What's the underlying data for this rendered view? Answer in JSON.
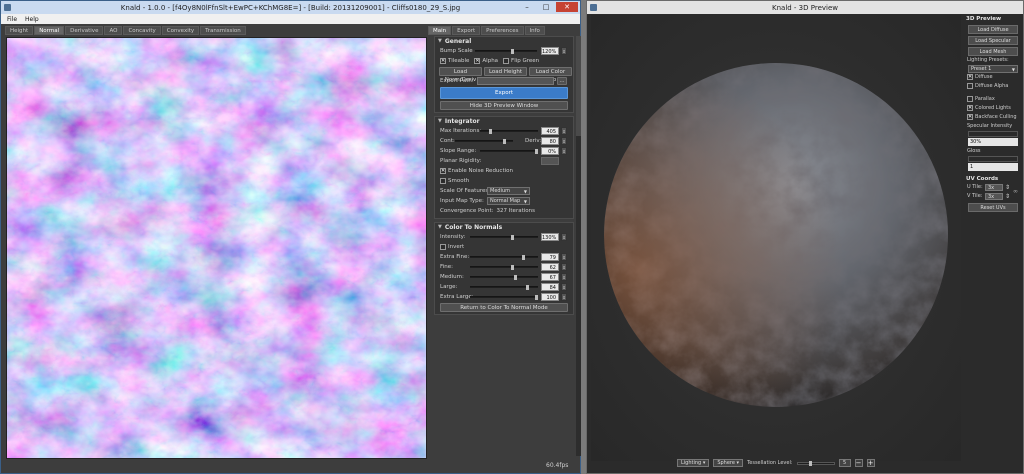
{
  "left_window": {
    "title": "Knald - 1.0.0 - [f4Oy8N0lFfnSlt+EwPC+KChMG8E=] - [Build: 20131209001] - Cliffs0180_29_S.jpg",
    "menu": [
      "File",
      "Help"
    ],
    "map_tabs": [
      "Height",
      "Normal",
      "Derivative",
      "AO",
      "Concavity",
      "Convexity",
      "Transmission"
    ],
    "active_map_tab": "Normal",
    "panel_tabs": [
      "Main",
      "Export",
      "Preferences",
      "Info"
    ],
    "active_panel_tab": "Main",
    "fps": "60.4fps",
    "general": {
      "title": "General",
      "bump_scale_label": "Bump Scale",
      "bump_scale_value": "120%",
      "bump_scale_level": 0.6,
      "tileable": "Tileable",
      "alpha": "Alpha",
      "flip_green": "Flip Green",
      "load_norm_deriv": "Load Norm/Deriv",
      "load_height_map": "Load Height Map",
      "load_color_map": "Load Color Map",
      "export_path_label": "Export Path:",
      "export_path_value": "",
      "browse": "...",
      "export_button": "Export",
      "hide_preview": "Hide 3D Preview Window"
    },
    "integrator": {
      "title": "Integrator",
      "max_iterations_label": "Max Iterations:",
      "max_iterations_value": "405",
      "max_iterations_level": 0.18,
      "cont_label": "Cont:",
      "cont_level": 0.85,
      "deriv_label": "Deriv:",
      "deriv_value": "80",
      "slope_range_label": "Slope Range:",
      "slope_range_value": "0%",
      "slope_range_level": 0.98,
      "planar_rigidity_label": "Planar Rigidity:",
      "enable_noise_reduction": "Enable Noise Reduction",
      "smooth": "Smooth",
      "scale_features_label": "Scale Of Features:",
      "scale_features_value": "Medium",
      "input_map_type_label": "Input Map Type:",
      "input_map_type_value": "Normal Map",
      "convergence_label": "Convergence Point:",
      "convergence_value": "327 Iterations"
    },
    "color_to_normals": {
      "title": "Color To Normals",
      "intensity_label": "Intensity:",
      "intensity_value": "130%",
      "intensity_level": 0.62,
      "invert": "Invert",
      "sliders": [
        {
          "label": "Extra Fine:",
          "value": "79",
          "level": 0.79
        },
        {
          "label": "Fine:",
          "value": "62",
          "level": 0.62
        },
        {
          "label": "Medium:",
          "value": "67",
          "level": 0.67
        },
        {
          "label": "Large:",
          "value": "84",
          "level": 0.84
        },
        {
          "label": "Extra Large:",
          "value": "100",
          "level": 1.0
        }
      ],
      "return_button": "Return to Color To Normal Mode"
    }
  },
  "right_window": {
    "title": "Knald - 3D Preview",
    "preview_title": "3D Preview",
    "load_diffuse": "Load Diffuse",
    "load_specular": "Load Specular",
    "load_mesh": "Load Mesh",
    "lighting_presets_label": "Lighting Presets:",
    "lighting_presets_value": "Preset 1",
    "diffuse": "Diffuse",
    "diffuse_alpha": "Diffuse Alpha",
    "parallax": "Parallax",
    "colored_lights": "Colored Lights",
    "backface_culling": "Backface Culling",
    "specular_intensity_label": "Specular Intensity",
    "specular_intensity_value": "30%",
    "gloss_label": "Gloss",
    "gloss_value": "1",
    "uv_coords_title": "UV Coords",
    "u_tile_label": "U Tile:",
    "u_tile_value": "3x",
    "v_tile_label": "V Tile:",
    "v_tile_value": "3x",
    "reset_uvs": "Reset UVs",
    "bottom": {
      "lighting": "Lighting",
      "mesh": "Sphere",
      "tessellation_label": "Tessellation Level:",
      "tessellation_value": "5",
      "tessellation_level": 0.35,
      "minus": "−",
      "plus": "+"
    }
  },
  "colors": {
    "accent_blue": "#3b7cc9",
    "left_titlebar": "#c9daf0",
    "close_red": "#c64333"
  }
}
